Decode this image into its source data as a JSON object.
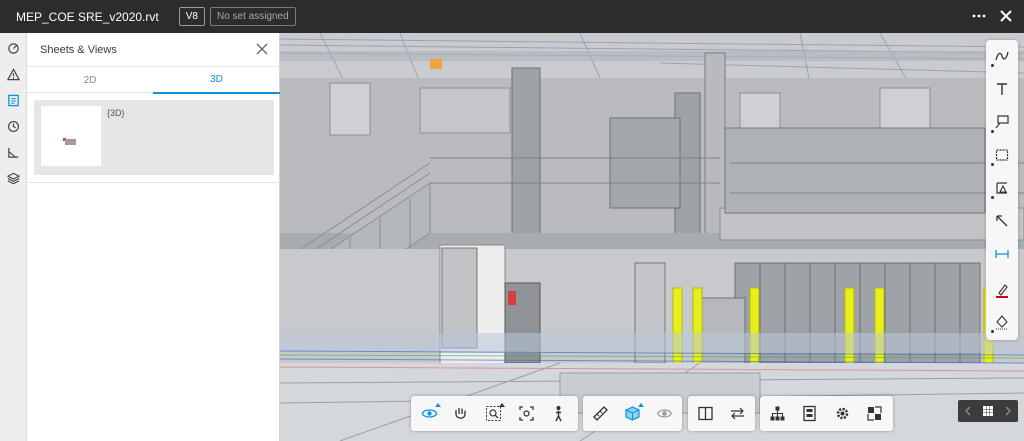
{
  "header": {
    "file_title": "MEP_COE SRE_v2020.rvt",
    "version": "V8",
    "set_status": "No set assigned",
    "more_icon": "more-horizontal-icon",
    "close_icon": "close-icon"
  },
  "left_rail": [
    {
      "name": "progress-icon"
    },
    {
      "name": "issues-warning-icon"
    },
    {
      "name": "sheets-views-icon"
    },
    {
      "name": "history-clock-icon"
    },
    {
      "name": "measure-icon"
    },
    {
      "name": "layers-icon"
    }
  ],
  "panel": {
    "title": "Sheets & Views",
    "tabs": [
      {
        "label": "2D",
        "active": false
      },
      {
        "label": "3D",
        "active": true
      }
    ],
    "views": [
      {
        "label": "{3D}"
      }
    ]
  },
  "right_tools": [
    {
      "name": "freehand-markup-icon"
    },
    {
      "name": "text-markup-icon"
    },
    {
      "name": "callout-markup-icon"
    },
    {
      "name": "rectangle-markup-icon"
    },
    {
      "name": "polygon-markup-icon"
    },
    {
      "name": "arrow-markup-icon"
    },
    {
      "name": "dimension-markup-icon"
    },
    {
      "name": "stroke-color-icon"
    },
    {
      "name": "fill-color-icon"
    }
  ],
  "bottom_toolbar": {
    "group1": [
      "orbit-icon",
      "pan-icon",
      "zoom-window-icon",
      "fit-to-view-icon",
      "first-person-icon"
    ],
    "group2": [
      "measure-ruler-icon",
      "section-box-icon",
      "explode-eye-icon"
    ],
    "group3": [
      "split-view-icon",
      "compare-arrows-icon"
    ],
    "group4": [
      "model-browser-icon",
      "properties-icon",
      "settings-icon",
      "fullscreen-icon"
    ]
  },
  "page_nav": [
    "previous-icon",
    "grid-icon",
    "next-icon"
  ],
  "colors": {
    "topbar": "#2c2c2c",
    "accent": "#0696d7",
    "safety_yellow": "#e8ef1a",
    "red_markup": "#d0021b"
  }
}
